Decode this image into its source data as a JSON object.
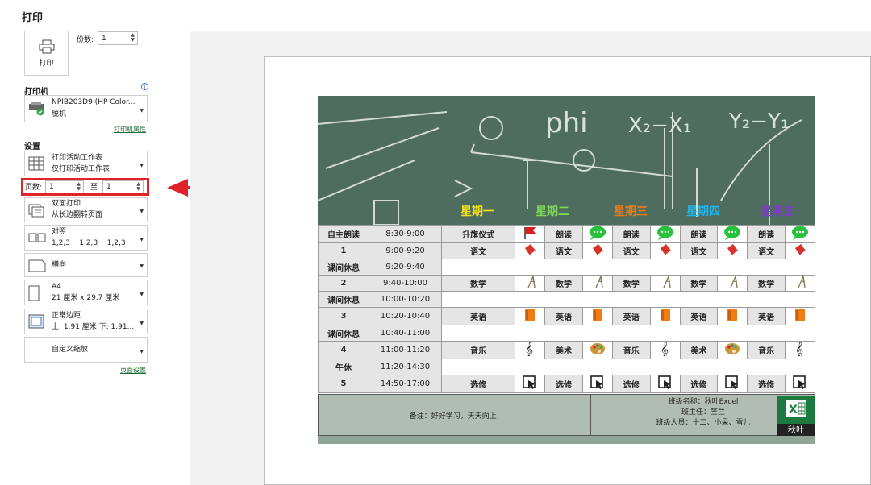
{
  "title": "打印",
  "print_button": "打印",
  "copies": {
    "label": "份数:",
    "value": "1"
  },
  "printer": {
    "section": "打印机",
    "name": "NPIB203D9 (HP Color...",
    "status": "脱机",
    "properties_link": "打印机属性"
  },
  "settings": {
    "section": "设置",
    "what": {
      "line1": "打印活动工作表",
      "line2": "仅打印活动工作表"
    },
    "pages": {
      "label": "页数:",
      "from": "1",
      "to_label": "至",
      "to": "1"
    },
    "duplex": {
      "line1": "双面打印",
      "line2": "从长边翻转页面"
    },
    "collate": {
      "line1": "对照",
      "line2": "1,2,3    1,2,3    1,2,3"
    },
    "orientation": {
      "line1": "横向"
    },
    "paper": {
      "line1": "A4",
      "line2": "21 厘米 x 29.7 厘米"
    },
    "margins": {
      "line1": "正常边距",
      "line2": "上: 1.91 厘米 下: 1.91..."
    },
    "scaling": {
      "line1": "自定义缩放"
    },
    "page_setup_link": "页面设置"
  },
  "timetable": {
    "board_text": [
      "phi",
      "X₂−X₁",
      "Y₂−Y₁"
    ],
    "days": [
      "星期一",
      "星期二",
      "星期三",
      "星期四",
      "星期五"
    ],
    "day_colors": [
      "#f5e514",
      "#7ed957",
      "#f07c16",
      "#1fb6ee",
      "#7b3fc4"
    ],
    "rows": [
      {
        "period": "自主朗读",
        "time": "8:30-9:00",
        "subjects": [
          "升旗仪式",
          "朗读",
          "朗读",
          "朗读",
          "朗读"
        ],
        "icons": [
          "flag-icon",
          "chat-icon",
          "chat-icon",
          "chat-icon",
          "chat-icon"
        ]
      },
      {
        "period": "1",
        "time": "9:00-9:20",
        "subjects": [
          "语文",
          "语文",
          "语文",
          "语文",
          "语文"
        ],
        "icons": [
          "book-icon",
          "book-icon",
          "book-icon",
          "book-icon",
          "book-icon"
        ]
      },
      {
        "period": "课间休息",
        "time": "9:20-9:40",
        "break": true
      },
      {
        "period": "2",
        "time": "9:40-10:00",
        "subjects": [
          "数学",
          "数学",
          "数学",
          "数学",
          "数学"
        ],
        "icons": [
          "compass-icon",
          "compass-icon",
          "compass-icon",
          "compass-icon",
          "compass-icon"
        ]
      },
      {
        "period": "课间休息",
        "time": "10:00-10:20",
        "break": true
      },
      {
        "period": "3",
        "time": "10:20-10:40",
        "subjects": [
          "英语",
          "英语",
          "英语",
          "英语",
          "英语"
        ],
        "icons": [
          "dictionary-icon",
          "dictionary-icon",
          "dictionary-icon",
          "dictionary-icon",
          "dictionary-icon"
        ]
      },
      {
        "period": "课间休息",
        "time": "10:40-11:00",
        "break": true
      },
      {
        "period": "4",
        "time": "11:00-11:20",
        "subjects": [
          "音乐",
          "美术",
          "音乐",
          "美术",
          "音乐"
        ],
        "icons": [
          "treble-clef-icon",
          "palette-icon",
          "treble-clef-icon",
          "palette-icon",
          "treble-clef-icon"
        ]
      },
      {
        "period": "午休",
        "time": "11:20-14:30",
        "break": true
      },
      {
        "period": "5",
        "time": "14:50-17:00",
        "subjects": [
          "选修",
          "选修",
          "选修",
          "选修",
          "选修"
        ],
        "icons": [
          "cursor-icon",
          "cursor-icon",
          "cursor-icon",
          "cursor-icon",
          "cursor-icon"
        ]
      }
    ],
    "note": "备注：好好学习，天天向上!",
    "class_name": "班级名称：秋叶Excel",
    "teacher": "班主任：竺兰",
    "members": "班级人员：十二、小呆、雪儿",
    "logo_text": "秋叶"
  }
}
